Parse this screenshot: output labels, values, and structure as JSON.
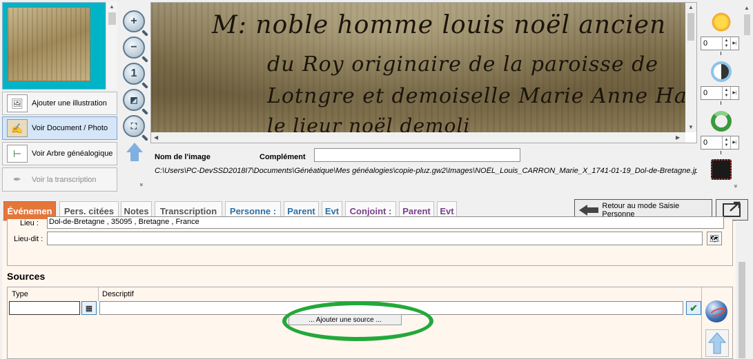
{
  "left_panel": {
    "buttons": [
      {
        "label": "Ajouter une illustration",
        "icon": "add-illustration-icon"
      },
      {
        "label": "Voir Document / Photo",
        "icon": "document-photo-icon"
      },
      {
        "label": "Voir Arbre généalogique",
        "icon": "family-tree-icon"
      },
      {
        "label": "Voir la transcription",
        "icon": "quill-icon"
      }
    ]
  },
  "zoom_tools": {
    "zoom_in": "+",
    "zoom_out": "−",
    "actual_size": "1",
    "zoom_fit": "◩",
    "fullscreen": "⛶",
    "more": "»"
  },
  "viewer": {
    "handwriting": [
      "M: noble homme louis noël ancien",
      "du Roy originaire de la paroisse de",
      "Lotngre et demoiselle Marie Anne Ha",
      "                    le lieur noël demoli"
    ],
    "image_name_label": "Nom de l'image",
    "complement_label": "Complément",
    "complement_value": "",
    "path": "C:\\Users\\PC-DevSSD2018I7\\Documents\\Généatique\\Mes généalogies\\copie-pluz.gw2\\Images\\NOËL_Louis_CARRON_Marie_X_1741-01-19_Dol-de-Bretagne.jpg"
  },
  "image_tools": {
    "brightness": {
      "icon": "brightness-sun-icon",
      "value": "0"
    },
    "contrast": {
      "icon": "contrast-icon",
      "value": "0"
    },
    "rotate": {
      "icon": "rotate-icon",
      "value": "0"
    },
    "effect": {
      "icon": "image-effect-icon"
    },
    "more": "»"
  },
  "tabs": [
    {
      "label": "Événemen",
      "style": "active"
    },
    {
      "label": "Pers. citées",
      "style": "normal"
    },
    {
      "label": "Notes",
      "style": "normal"
    },
    {
      "label": "Transcription",
      "style": "normal"
    },
    {
      "label": "Personne :",
      "style": "blue"
    },
    {
      "label": "Parent",
      "style": "blue"
    },
    {
      "label": "Evt",
      "style": "blue"
    },
    {
      "label": "Conjoint :",
      "style": "purple"
    },
    {
      "label": "Parent",
      "style": "purple"
    },
    {
      "label": "Evt",
      "style": "purple"
    }
  ],
  "retour_button": "Retour au mode Saisie Personne",
  "event": {
    "lieu_label": "Lieu :",
    "lieu_value": "Dol-de-Bretagne , 35095 , Bretagne , France",
    "lieu_dit_label": "Lieu-dit :",
    "lieu_dit_value": ""
  },
  "sources": {
    "title": "Sources",
    "col_type": "Type",
    "col_descriptif": "Descriptif",
    "type_value": "",
    "descriptif_value": "",
    "add_button": "... Ajouter une source ..."
  },
  "colors": {
    "active_tab": "#e4763a",
    "person_tab": "#2d6fa6",
    "spouse_tab": "#7a3f8a",
    "highlight_oval": "#23a83a"
  }
}
